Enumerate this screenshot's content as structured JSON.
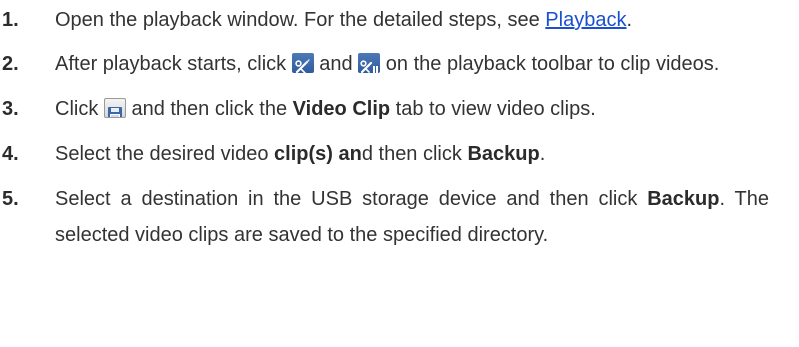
{
  "steps": [
    {
      "num": "1.",
      "t1": "Open the playback window. For the detailed steps, see ",
      "link": "Playback",
      "t2": "."
    },
    {
      "num": "2.",
      "t1": "After playback starts, click ",
      "icon_a": "clip-start-icon",
      "t2": " and ",
      "icon_b": "clip-end-icon",
      "t3": " on the playback toolbar to clip videos."
    },
    {
      "num": "3.",
      "t1": "Click ",
      "icon": "save-icon",
      "t2": " and then click the ",
      "b1": "Video Clip",
      "t3": " tab to view video clips."
    },
    {
      "num": "4.",
      "t1": "Select the desired video ",
      "b1": "clip(s) an",
      "t2": "d then click ",
      "b2": "Backup",
      "t3": "."
    },
    {
      "num": "5.",
      "t1": "Select a destination in the USB storage device and then click ",
      "b1": "Backup",
      "t2": ". The selected video clips are saved to the specified directory."
    }
  ],
  "colors": {
    "text": "#333333",
    "link": "#1a4fd0",
    "icon_blue": "#3a67a8"
  }
}
